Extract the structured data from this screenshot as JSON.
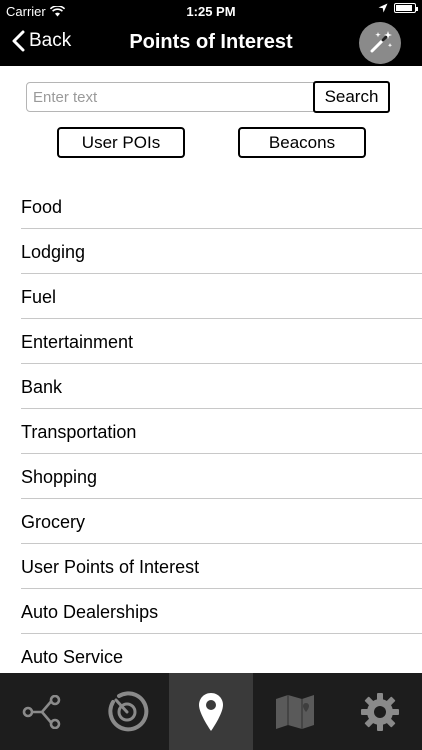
{
  "status_bar": {
    "carrier": "Carrier",
    "time": "1:25 PM",
    "icons": [
      "wifi-icon",
      "location-arrow-icon",
      "battery-icon"
    ],
    "battery_level": 0.9
  },
  "nav": {
    "back_label": "Back",
    "title": "Points of Interest",
    "action_icon": "magic-wand-icon"
  },
  "search": {
    "placeholder": "Enter text",
    "value": "",
    "button_label": "Search"
  },
  "filters": {
    "user_pois_label": "User POIs",
    "beacons_label": "Beacons"
  },
  "categories": [
    "Food",
    "Lodging",
    "Fuel",
    "Entertainment",
    "Bank",
    "Transportation",
    "Shopping",
    "Grocery",
    "User Points of Interest",
    "Auto Dealerships",
    "Auto Service"
  ],
  "tabbar": {
    "tabs": [
      {
        "icon": "route-nodes-icon",
        "active": false
      },
      {
        "icon": "radar-icon",
        "active": false
      },
      {
        "icon": "map-pin-icon",
        "active": true
      },
      {
        "icon": "map-icon",
        "active": false
      },
      {
        "icon": "gear-icon",
        "active": false
      }
    ]
  },
  "colors": {
    "header_bg": "#000000",
    "tabbar_bg": "#1d1d1d",
    "active_tab_bg": "#3a3a3a",
    "icon_gray": "#8a8a8a",
    "separator": "#c8c8c8"
  }
}
